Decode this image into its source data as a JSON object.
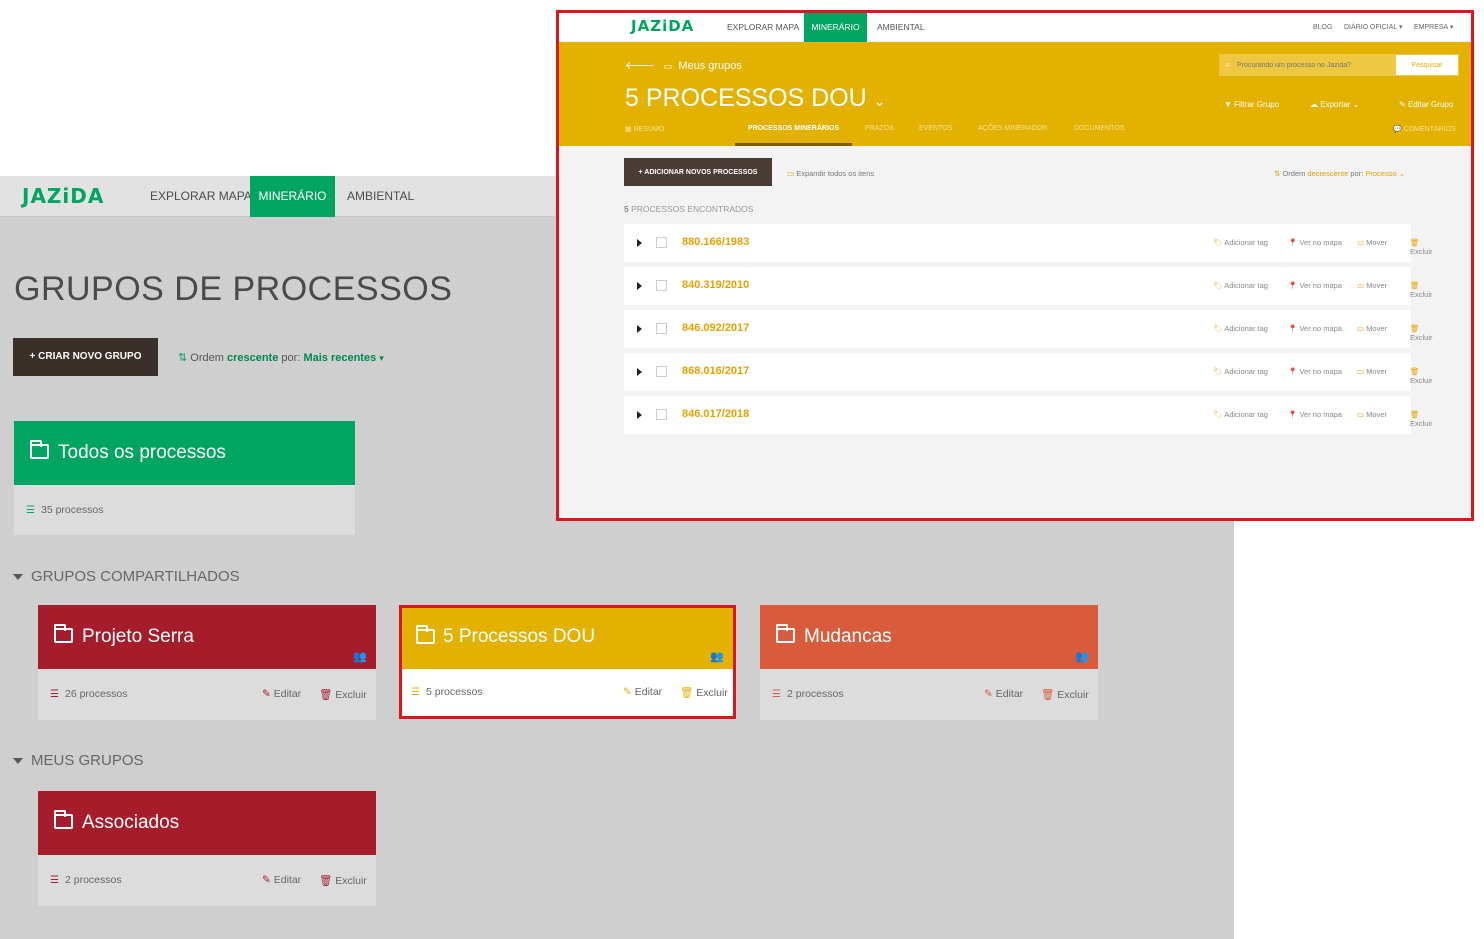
{
  "background_page": {
    "logo": "JAZiDA",
    "nav": [
      "EXPLORAR MAPA",
      "MINERÁRIO",
      "AMBIENTAL"
    ],
    "title": "GRUPOS DE PROCESSOS",
    "create_button": "+ CRIAR NOVO GRUPO",
    "order": {
      "prefix": "Ordem",
      "direction": "crescente",
      "by_label": "por:",
      "by_value": "Mais recentes"
    },
    "all_group": {
      "title": "Todos os processos",
      "count": "35 processos",
      "color": "#00a562"
    },
    "shared_section": "GRUPOS COMPARTILHADOS",
    "shared_groups": [
      {
        "title": "Projeto Serra",
        "count": "26 processos",
        "color": "#a51d2b"
      },
      {
        "title": "5 Processos DOU",
        "count": "5 processos",
        "color": "#e3b100"
      },
      {
        "title": "Mudancas",
        "count": "2 processos",
        "color": "#d85c3c"
      }
    ],
    "my_section": "MEUS GRUPOS",
    "my_groups": [
      {
        "title": "Associados",
        "count": "2 processos",
        "color": "#a51d2b"
      }
    ],
    "edit_label": "Editar",
    "delete_label": "Excluir"
  },
  "panel": {
    "logo": "JAZiDA",
    "nav": [
      "EXPLORAR MAPA",
      "MINERÁRIO",
      "AMBIENTAL"
    ],
    "right_nav": [
      "BLOG",
      "DIÁRIO OFICIAL",
      "EMPRESA"
    ],
    "back_label": "Meus grupos",
    "title": "5 PROCESSOS DOU",
    "search": {
      "placeholder": "Procurando um processo no Jazida?",
      "button": "Pesquisar"
    },
    "actions": [
      "Filtrar Grupo",
      "Exportar",
      "Editar Grupo"
    ],
    "tabs": [
      "RESUMO",
      "PROCESSOS MINERÁRIOS",
      "PRAZOS",
      "EVENTOS",
      "AÇÕES MINERADOR",
      "DOCUMENTOS",
      "COMENTÁRIOS"
    ],
    "add_button": "+ ADICIONAR NOVOS PROCESSOS",
    "expand_label": "Expandir todos os itens",
    "order": {
      "prefix": "Ordem",
      "direction": "decrescente",
      "by_label": "por:",
      "by_value": "Processo"
    },
    "found": {
      "count": "5",
      "label": "PROCESSOS ENCONTRADOS"
    },
    "row_actions": [
      "Adicionar tag",
      "Ver no mapa",
      "Mover",
      "Excluir"
    ],
    "processes": [
      "880.166/1983",
      "840.319/2010",
      "846.092/2017",
      "868.016/2017",
      "846.017/2018"
    ]
  }
}
